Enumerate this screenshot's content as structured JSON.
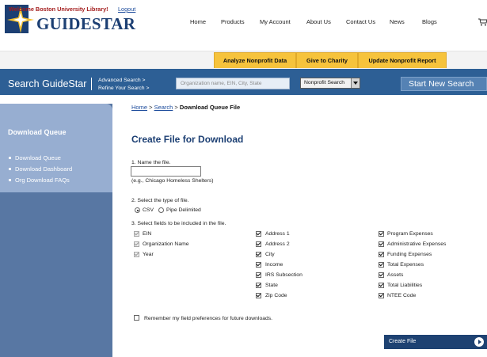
{
  "brand": {
    "name": "GUIDESTAR"
  },
  "topnav": [
    "Home",
    "Products",
    "My Account",
    "About Us",
    "Contact Us",
    "News",
    "Blogs"
  ],
  "welcome_bar": {
    "welcome": "Welcome Boston University Library!",
    "logout": "Logout",
    "tabs": [
      "Analyze Nonprofit Data",
      "Give to Charity",
      "Update Nonprofit Report"
    ]
  },
  "search": {
    "title": "Search GuideStar",
    "advanced": "Advanced Search >",
    "refine": "Refine Your Search >",
    "placeholder": "Organization name, EIN, City, State",
    "select_value": "Nonprofit Search",
    "new_search": "Start New Search"
  },
  "sidebar": {
    "title": "Download Queue",
    "links": [
      "Download Queue",
      "Download Dashboard",
      "Org Download FAQs"
    ]
  },
  "breadcrumb": {
    "home": "Home",
    "sep1": " > ",
    "search": "Search",
    "sep2": " > ",
    "current": "Download Queue File"
  },
  "main": {
    "title": "Create File for Download",
    "step1_label": "1. Name the file.",
    "step1_hint": "(e.g., Chicago Homeless Shelters)",
    "step2_label": "2. Select the type of file.",
    "file_types": [
      {
        "label": "CSV",
        "selected": true
      },
      {
        "label": "Pipe Delimited",
        "selected": false
      }
    ],
    "step3_label": "3. Select fields to be included in the file.",
    "fields_col1": [
      "EIN",
      "Organization Name",
      "Year"
    ],
    "fields_col2": [
      "Address 1",
      "Address 2",
      "City",
      "Income",
      "IRS Subsection",
      "State",
      "Zip Code"
    ],
    "fields_col3": [
      "Program Expenses",
      "Administrative Expenses",
      "Funding Expenses",
      "Total Expenses",
      "Assets",
      "Total Liabilities",
      "NTEE Code"
    ],
    "remember": "Remember my field preferences for future downloads.",
    "create_button": "Create File"
  },
  "colors": {
    "brand_blue": "#1c3f73",
    "search_bar": "#2d5f95",
    "tab_yellow": "#f6c33c",
    "sidebar": "#5877a3",
    "sidebar_panel": "#97aed1",
    "welcome_red": "#a31c1c"
  }
}
